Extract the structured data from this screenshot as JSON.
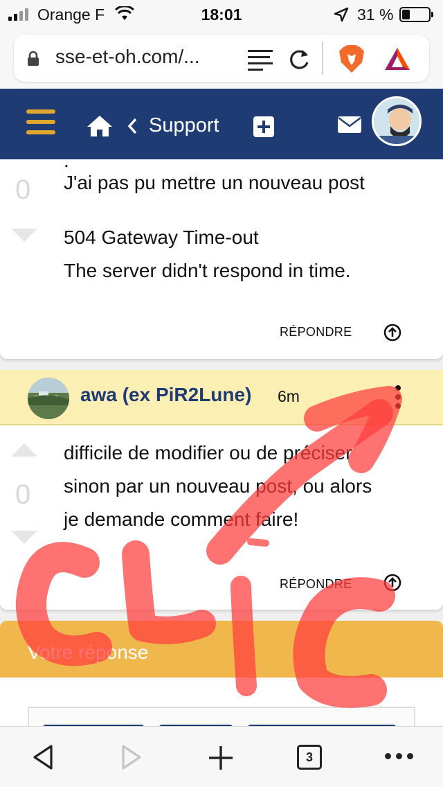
{
  "status_bar": {
    "carrier": "Orange F",
    "time": "18:01",
    "battery": "31 %"
  },
  "browser": {
    "url": "sse-et-oh.com/...",
    "open_tabs": "3"
  },
  "header": {
    "title": "Support",
    "bg_color": "#1f3b73",
    "accent_color": "#e0a72e"
  },
  "post1": {
    "vote_count": "0",
    "lines": [
      "J'ai pas pu mettre un nouveau post",
      "504 Gateway Time-out",
      "The server didn't respond in time."
    ],
    "reply_label": "RÉPONDRE"
  },
  "post2": {
    "author": "awa (ex PiR2Lune)",
    "time": "6m",
    "vote_count": "0",
    "lines": [
      "difficile de modifier ou de préciser",
      "sinon par un nouveau post, ou alors",
      "je demande comment faire!"
    ],
    "reply_label": "RÉPONDRE"
  },
  "answer": {
    "title": "Votre réponse",
    "header_color": "#f0b84c"
  },
  "annotation": {
    "text": "CLIC",
    "color": "#ff3b3b"
  }
}
